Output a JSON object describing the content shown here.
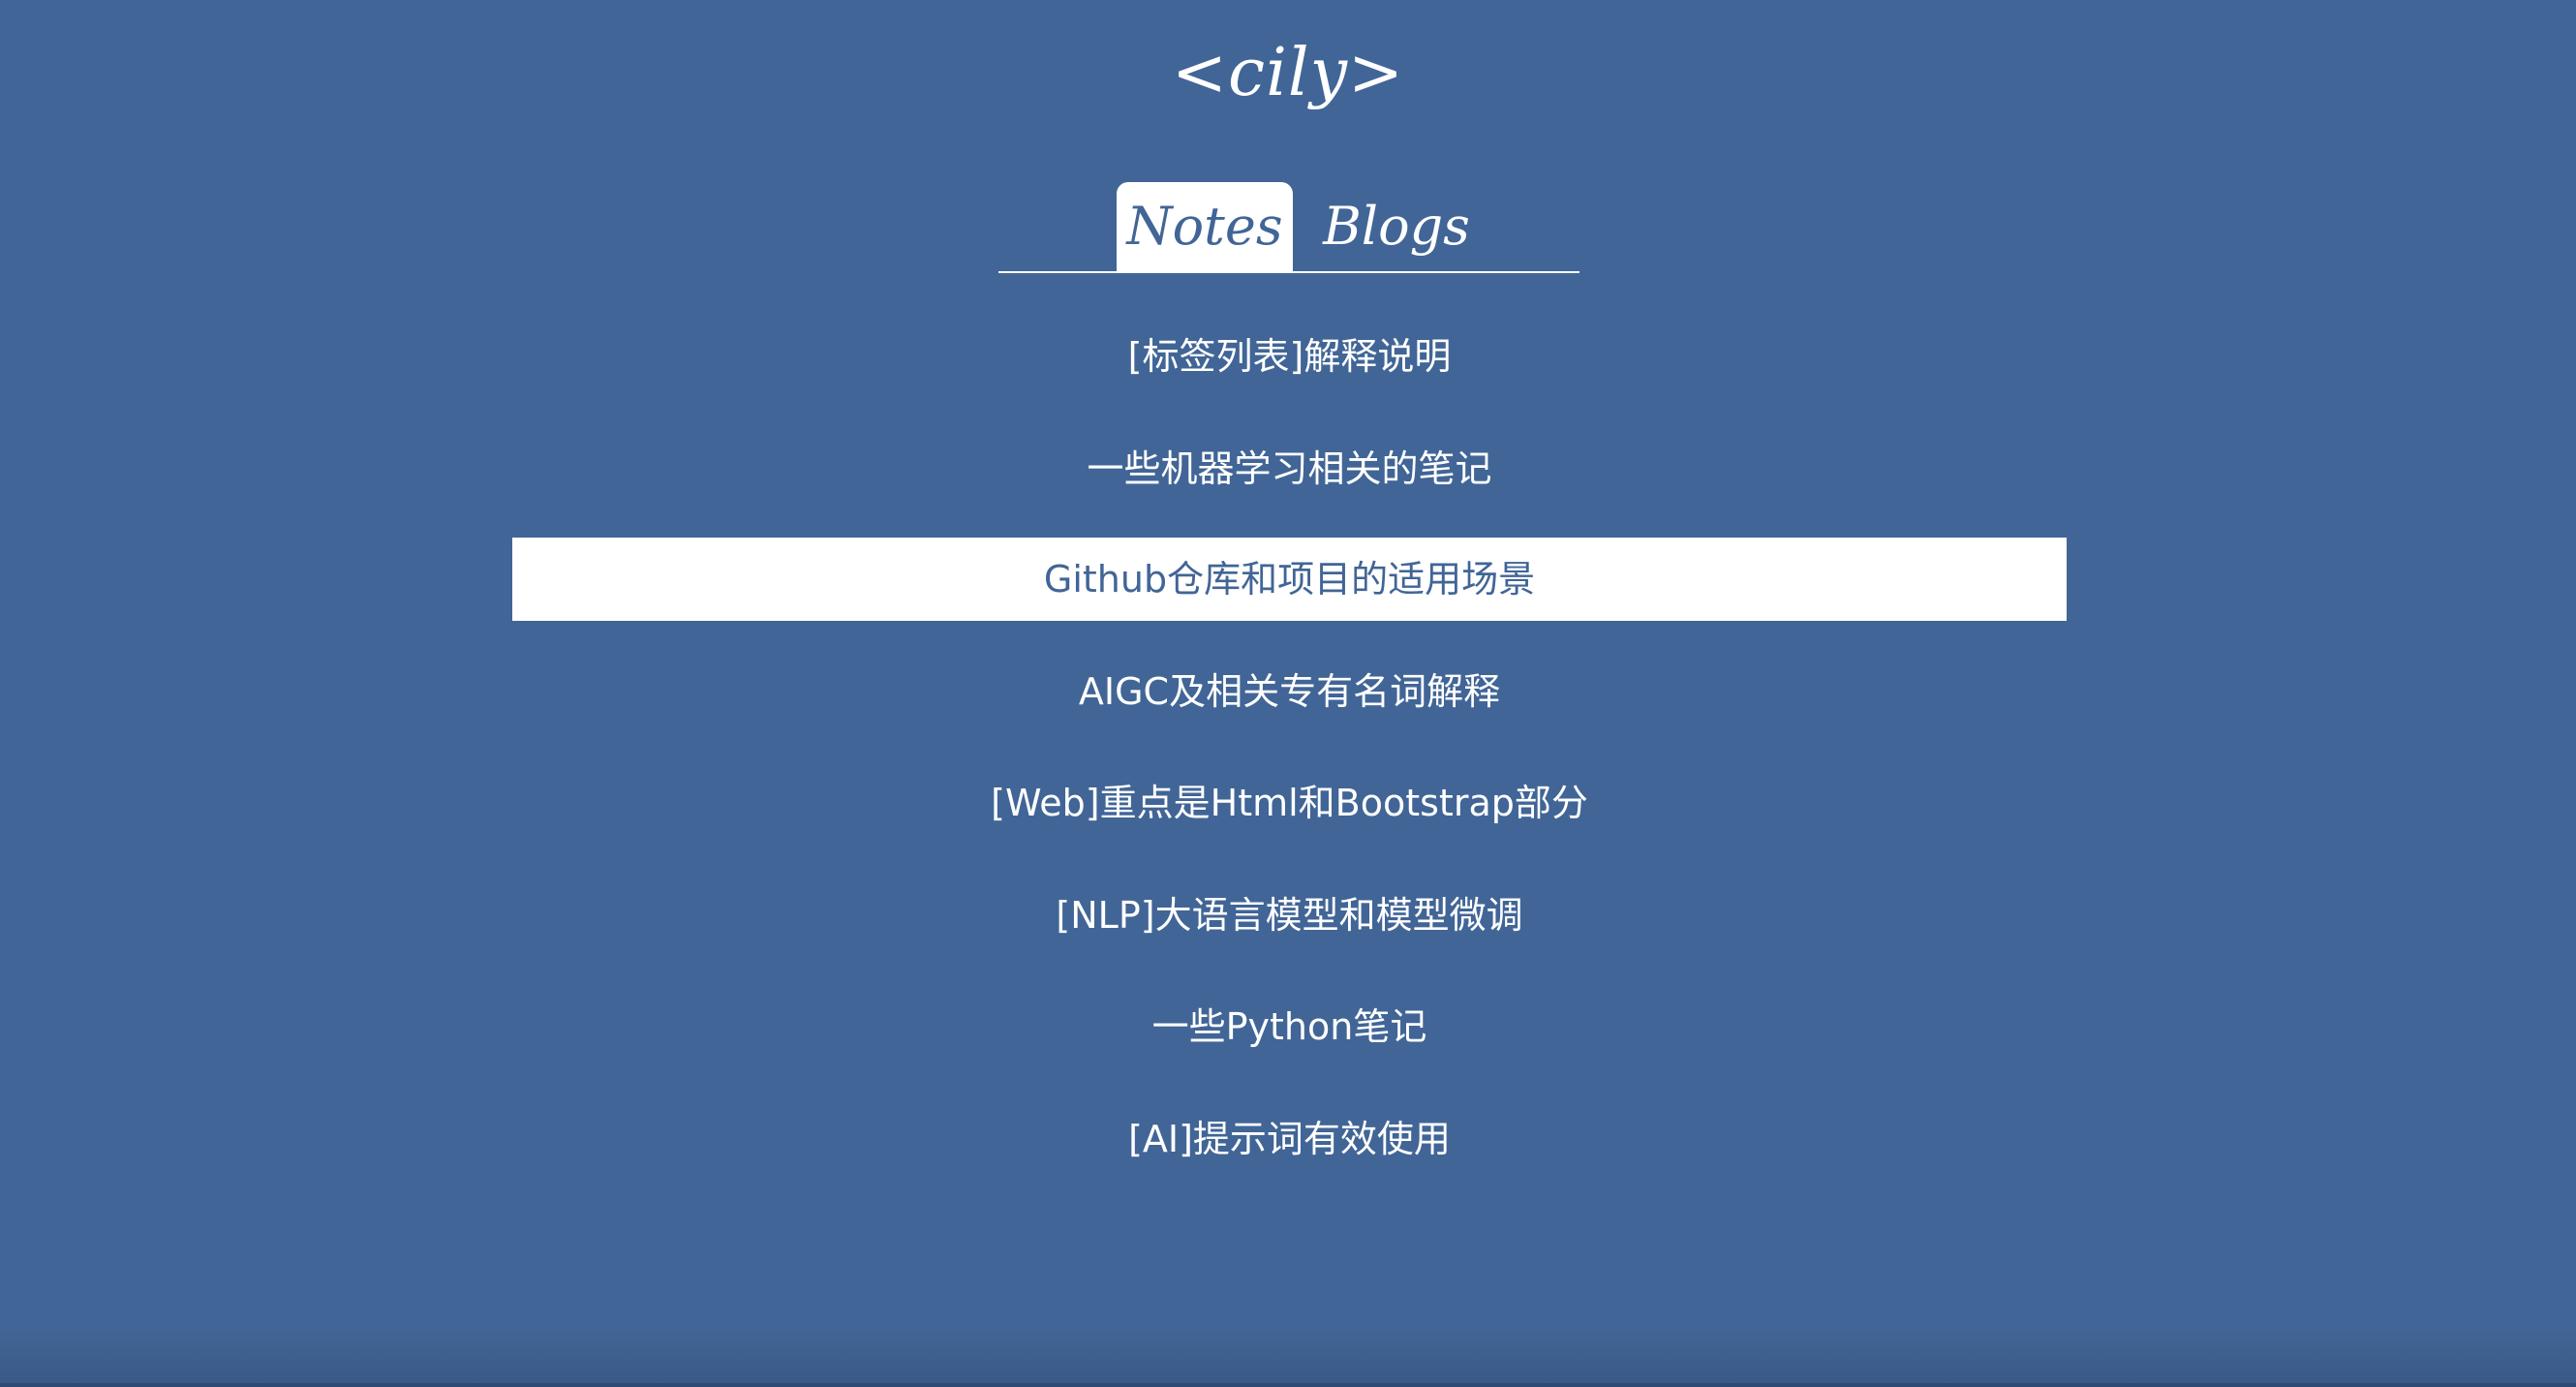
{
  "site": {
    "title": "<cily>"
  },
  "tabs": [
    {
      "label": "Notes",
      "active": true
    },
    {
      "label": "Blogs",
      "active": false
    }
  ],
  "notes": [
    {
      "label": "[标签列表]解释说明"
    },
    {
      "label": "一些机器学习相关的笔记"
    },
    {
      "label": "Github仓库和项目的适用场景",
      "highlighted": true
    },
    {
      "label": "AIGC及相关专有名词解释"
    },
    {
      "label": "[Web]重点是Html和Bootstrap部分"
    },
    {
      "label": "[NLP]大语言模型和模型微调"
    },
    {
      "label": "一些Python笔记"
    },
    {
      "label": "[AI]提示词有效使用"
    }
  ],
  "colors": {
    "background": "#416596",
    "foreground": "#ffffff"
  }
}
